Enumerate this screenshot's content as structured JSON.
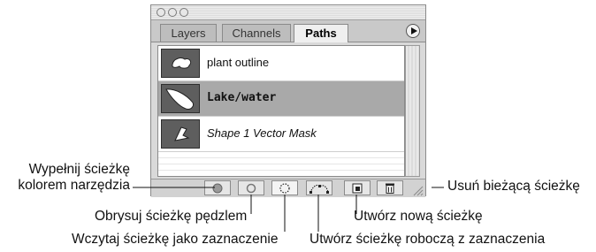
{
  "panel": {
    "tabs": [
      {
        "label": "Layers",
        "active": false
      },
      {
        "label": "Channels",
        "active": false
      },
      {
        "label": "Paths",
        "active": true
      }
    ],
    "paths": [
      {
        "label": "plant outline",
        "style": "normal",
        "selected": false,
        "thumb_icon": "plant-shape-icon"
      },
      {
        "label": "Lake/water",
        "style": "bold",
        "selected": true,
        "thumb_icon": "lake-shape-icon"
      },
      {
        "label": "Shape 1 Vector Mask",
        "style": "italic",
        "selected": false,
        "thumb_icon": "vector-mask-shape-icon"
      }
    ],
    "bottom_buttons": [
      {
        "name": "fill-path-button",
        "icon": "filled-circle-icon"
      },
      {
        "name": "stroke-path-button",
        "icon": "hollow-circle-icon"
      },
      {
        "name": "load-selection-button",
        "icon": "dotted-circle-icon"
      },
      {
        "name": "make-work-path-button",
        "icon": "work-path-icon"
      },
      {
        "name": "new-path-button",
        "icon": "new-page-icon"
      },
      {
        "name": "delete-path-button",
        "icon": "trash-icon"
      }
    ]
  },
  "annotations": {
    "fill_line1": "Wypełnij ścieżkę",
    "fill_line2": "kolorem narzędzia",
    "stroke": "Obrysuj ścieżkę pędzlem",
    "load_selection": "Wczytaj ścieżkę jako zaznaczenie",
    "new_path": "Utwórz nową ścieżkę",
    "work_path": "Utwórz ścieżkę roboczą z zaznaczenia",
    "delete": "Usuń bieżącą ścieżkę"
  }
}
